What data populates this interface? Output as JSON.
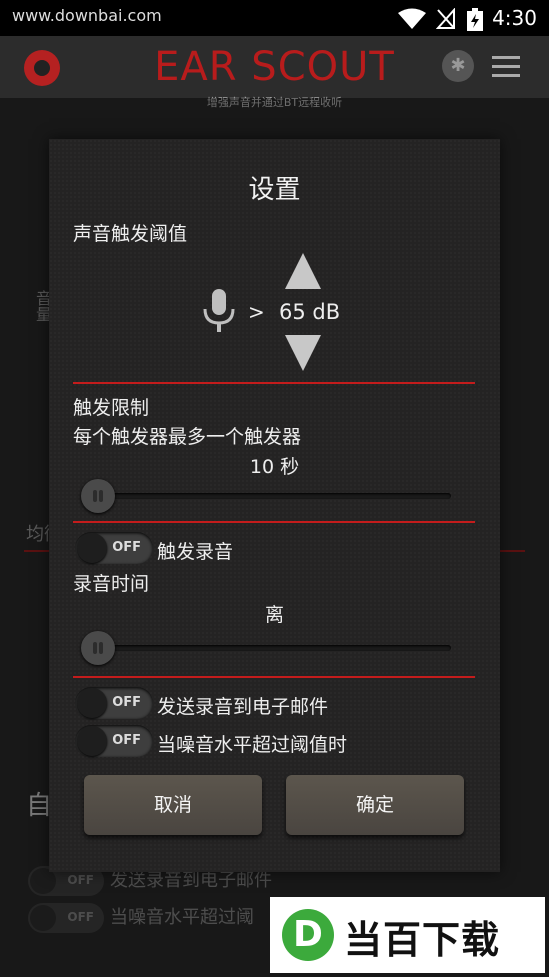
{
  "status_bar": {
    "url": "www.downbai.com",
    "time": "4:30"
  },
  "app": {
    "title": "EAR SCOUT",
    "subtitle": "增强声音并通过BT远程收听"
  },
  "background": {
    "vertical_label": "音量",
    "eq_label": "均衡",
    "big_label": "自",
    "row1": "发送录音到电子邮件",
    "row2": "当噪音水平超过阈",
    "toggle_off": "OFF"
  },
  "dialog": {
    "title": "设置",
    "threshold_label": "声音触发阈值",
    "comparator": ">",
    "threshold_value": "65 dB",
    "trigger_limit_label": "触发限制",
    "trigger_limit_desc": "每个触发器最多一个触发器",
    "trigger_limit_value": "10 秒",
    "trigger_slider_level": 0,
    "record_toggle": {
      "state": "OFF",
      "label": "触发录音"
    },
    "record_time_label": "录音时间",
    "record_time_value": "离",
    "record_slider_level": 0,
    "email_toggle": {
      "state": "OFF",
      "label": "发送录音到电子邮件"
    },
    "noise_toggle": {
      "state": "OFF",
      "label": "当噪音水平超过阈值时"
    },
    "cancel_label": "取消",
    "confirm_label": "确定"
  },
  "watermark": {
    "letter": "D",
    "text": "当百下载"
  },
  "colors": {
    "accent_red": "#c41c1c",
    "title_red": "#b81c1c",
    "button": "#544f48"
  }
}
